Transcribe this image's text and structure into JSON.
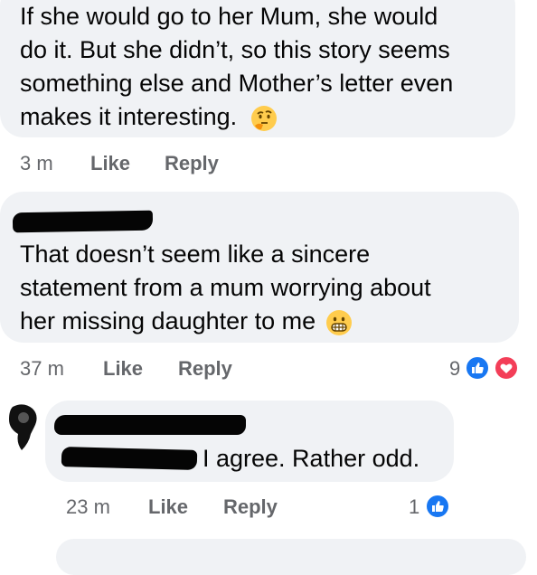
{
  "comments": [
    {
      "lines": [
        "If she would go to her Mum, she would",
        "do it. But she didn’t, so this story seems",
        "something else and Mother’s letter even",
        "makes it interesting."
      ],
      "emoji": "thinking-face",
      "time": "3 m",
      "like_label": "Like",
      "reply_label": "Reply"
    },
    {
      "lines": [
        "That doesn’t seem like a sincere",
        "statement from a mum worrying about",
        "her missing daughter to me"
      ],
      "emoji": "grimacing-face",
      "time": "37 m",
      "like_label": "Like",
      "reply_label": "Reply",
      "reaction_count": "9",
      "reactions": [
        "like",
        "love"
      ]
    },
    {
      "text": "I agree. Rather odd.",
      "time": "23 m",
      "like_label": "Like",
      "reply_label": "Reply",
      "reaction_count": "1",
      "reactions": [
        "like"
      ]
    }
  ],
  "colors": {
    "bubble": "#f0f2f5",
    "meta": "#65676b",
    "like_blue": "#1877f2",
    "love_red": "#f33e58"
  }
}
